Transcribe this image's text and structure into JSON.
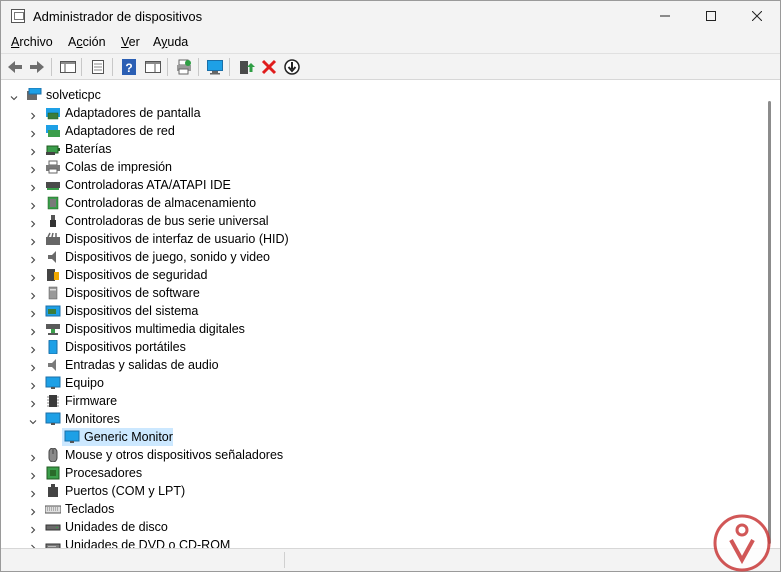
{
  "window": {
    "title": "Administrador de dispositivos"
  },
  "menu": [
    {
      "label": "Archivo",
      "accel": "A",
      "rest": "rchivo"
    },
    {
      "label": "Acción",
      "accel": "c",
      "pre": "A",
      "rest": "ción"
    },
    {
      "label": "Ver",
      "accel": "V",
      "rest": "er"
    },
    {
      "label": "Ayuda",
      "accel": "y",
      "pre": "A",
      "rest": "uda"
    }
  ],
  "toolbar": [
    "back-icon",
    "forward-icon",
    "show-hide-console-tree-icon",
    "properties-icon",
    "help-icon",
    "action-pane-icon",
    "print-icon",
    "scan-hardware-icon",
    "update-driver-icon",
    "uninstall-device-icon",
    "disable-device-icon"
  ],
  "tree": {
    "root": "solveticpc",
    "categories": [
      {
        "label": "Adaptadores de pantalla",
        "icon": "display-adapter-icon"
      },
      {
        "label": "Adaptadores de red",
        "icon": "network-adapter-icon"
      },
      {
        "label": "Baterías",
        "icon": "battery-icon"
      },
      {
        "label": "Colas de impresión",
        "icon": "printer-icon"
      },
      {
        "label": "Controladoras ATA/ATAPI IDE",
        "icon": "ide-controller-icon"
      },
      {
        "label": "Controladoras de almacenamiento",
        "icon": "storage-controller-icon"
      },
      {
        "label": "Controladoras de bus serie universal",
        "icon": "usb-icon"
      },
      {
        "label": "Dispositivos de interfaz de usuario (HID)",
        "icon": "hid-icon"
      },
      {
        "label": "Dispositivos de juego, sonido y video",
        "icon": "speaker-icon"
      },
      {
        "label": "Dispositivos de seguridad",
        "icon": "security-device-icon"
      },
      {
        "label": "Dispositivos de software",
        "icon": "software-device-icon"
      },
      {
        "label": "Dispositivos del sistema",
        "icon": "system-device-icon"
      },
      {
        "label": "Dispositivos multimedia digitales",
        "icon": "multimedia-icon"
      },
      {
        "label": "Dispositivos portátiles",
        "icon": "portable-device-icon"
      },
      {
        "label": "Entradas y salidas de audio",
        "icon": "audio-io-icon"
      },
      {
        "label": "Equipo",
        "icon": "computer-icon"
      },
      {
        "label": "Firmware",
        "icon": "firmware-icon"
      },
      {
        "label": "Monitores",
        "icon": "monitor-icon",
        "expanded": true,
        "children": [
          "Generic Monitor"
        ]
      },
      {
        "label": "Mouse y otros dispositivos señaladores",
        "icon": "mouse-icon"
      },
      {
        "label": "Procesadores",
        "icon": "processor-icon"
      },
      {
        "label": "Puertos (COM y LPT)",
        "icon": "port-icon"
      },
      {
        "label": "Teclados",
        "icon": "keyboard-icon"
      },
      {
        "label": "Unidades de disco",
        "icon": "disk-drive-icon"
      },
      {
        "label": "Unidades de DVD o CD-ROM",
        "icon": "dvd-drive-icon"
      }
    ]
  },
  "selected": "Generic Monitor",
  "colors": {
    "selection": "#cce8ff",
    "monitor": "#1ea0e6",
    "accent": "#2f7d32",
    "error": "#e01c1c"
  }
}
